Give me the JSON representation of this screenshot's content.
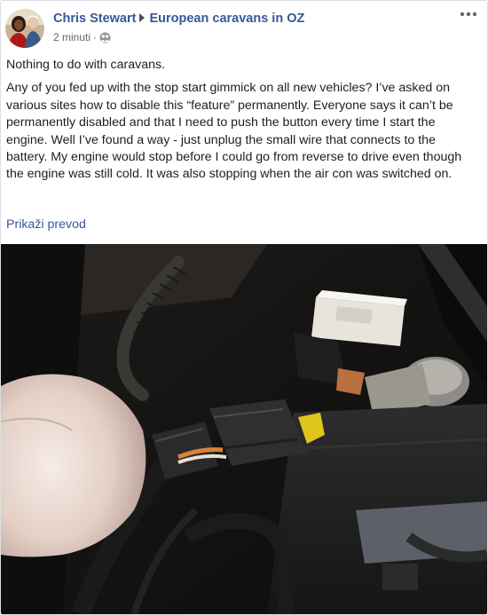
{
  "post": {
    "author": "Chris Stewart",
    "group": "European caravans in OZ",
    "time": "2 minuti",
    "privacy_icon": "group-icon",
    "menu_icon": "more-dots-icon",
    "paragraphs": [
      "Nothing to do with caravans.",
      "Any of you fed up with the stop start gimmick on all new vehicles? I’ve asked on various sites how to disable this “feature” permanently. Everyone says it can’t be permanently disabled and that I need to push the button every time I start the engine. Well I’ve found a way - just unplug the small wire that connects to the battery. My engine would stop before I could go from reverse to drive even though the engine was still cold. It was also stopping when the air con was switched on."
    ],
    "see_translation": "Prikaži prevod",
    "photo_icon": "engine-bay-photo"
  },
  "colors": {
    "link": "#365899",
    "text": "#1c1e21",
    "meta": "#606770",
    "border": "#dddfe2"
  }
}
